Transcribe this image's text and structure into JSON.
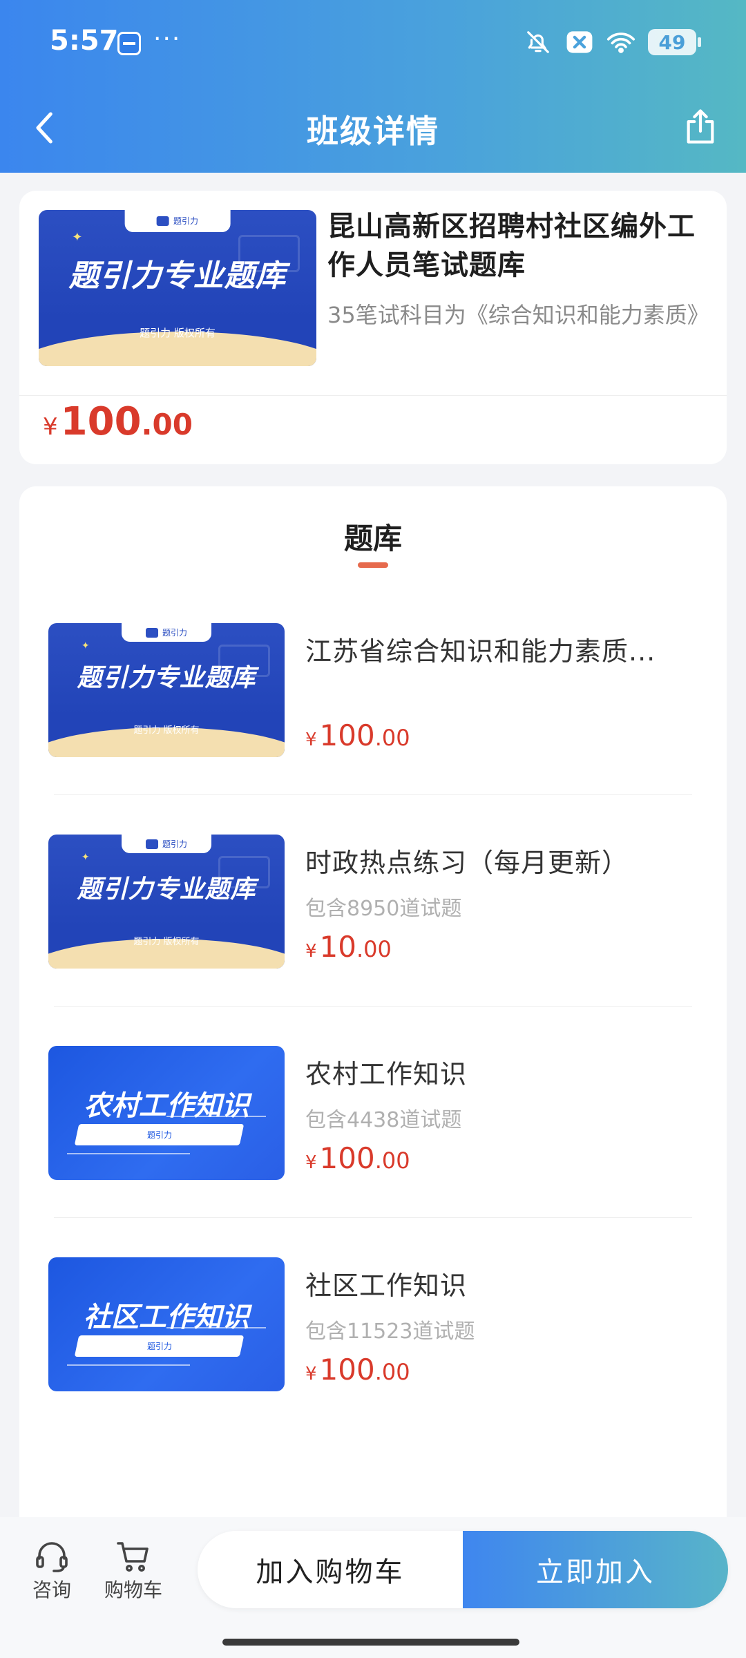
{
  "status_bar": {
    "time": "5:57",
    "dots": "···",
    "battery": "49"
  },
  "header": {
    "title": "班级详情"
  },
  "product": {
    "title": "昆山高新区招聘村社区编外工作人员笔试题库",
    "desc": "35笔试科目为《综合知识和能力素质》",
    "price": {
      "symbol": "¥",
      "int": "100",
      "dec": ".00"
    }
  },
  "thumb_a": {
    "tab_text": "题引力",
    "headline": "题引力专业题库",
    "footer": "题引力 版权所有"
  },
  "section": {
    "tab": "题库"
  },
  "items": [
    {
      "title": "江苏省综合知识和能力素质...",
      "sub": "",
      "price": {
        "symbol": "¥",
        "int": "100",
        "dec": ".00"
      }
    },
    {
      "title": "时政热点练习（每月更新）",
      "sub": "包含8950道试题",
      "price": {
        "symbol": "¥",
        "int": "10",
        "dec": ".00"
      }
    },
    {
      "title": "农村工作知识",
      "sub": "包含4438道试题",
      "price": {
        "symbol": "¥",
        "int": "100",
        "dec": ".00"
      },
      "thumb_headline": "农村工作知识",
      "thumb_bar": "题引力"
    },
    {
      "title": "社区工作知识",
      "sub": "包含11523道试题",
      "price": {
        "symbol": "¥",
        "int": "100",
        "dec": ".00"
      },
      "thumb_headline": "社区工作知识",
      "thumb_bar": "题引力"
    }
  ],
  "bottom": {
    "consult": "咨询",
    "cart": "购物车",
    "add_cart": "加入购物车",
    "join_now": "立即加入"
  },
  "colors": {
    "header_start": "#3b86ee",
    "header_end": "#55b8c4",
    "price": "#d93a2b",
    "tab_indicator": "#e66a4d"
  },
  "icons": [
    "back-icon",
    "share-icon",
    "bell-off-icon",
    "close-badge-icon",
    "wifi-icon",
    "battery-icon",
    "headset-icon",
    "cart-icon"
  ]
}
